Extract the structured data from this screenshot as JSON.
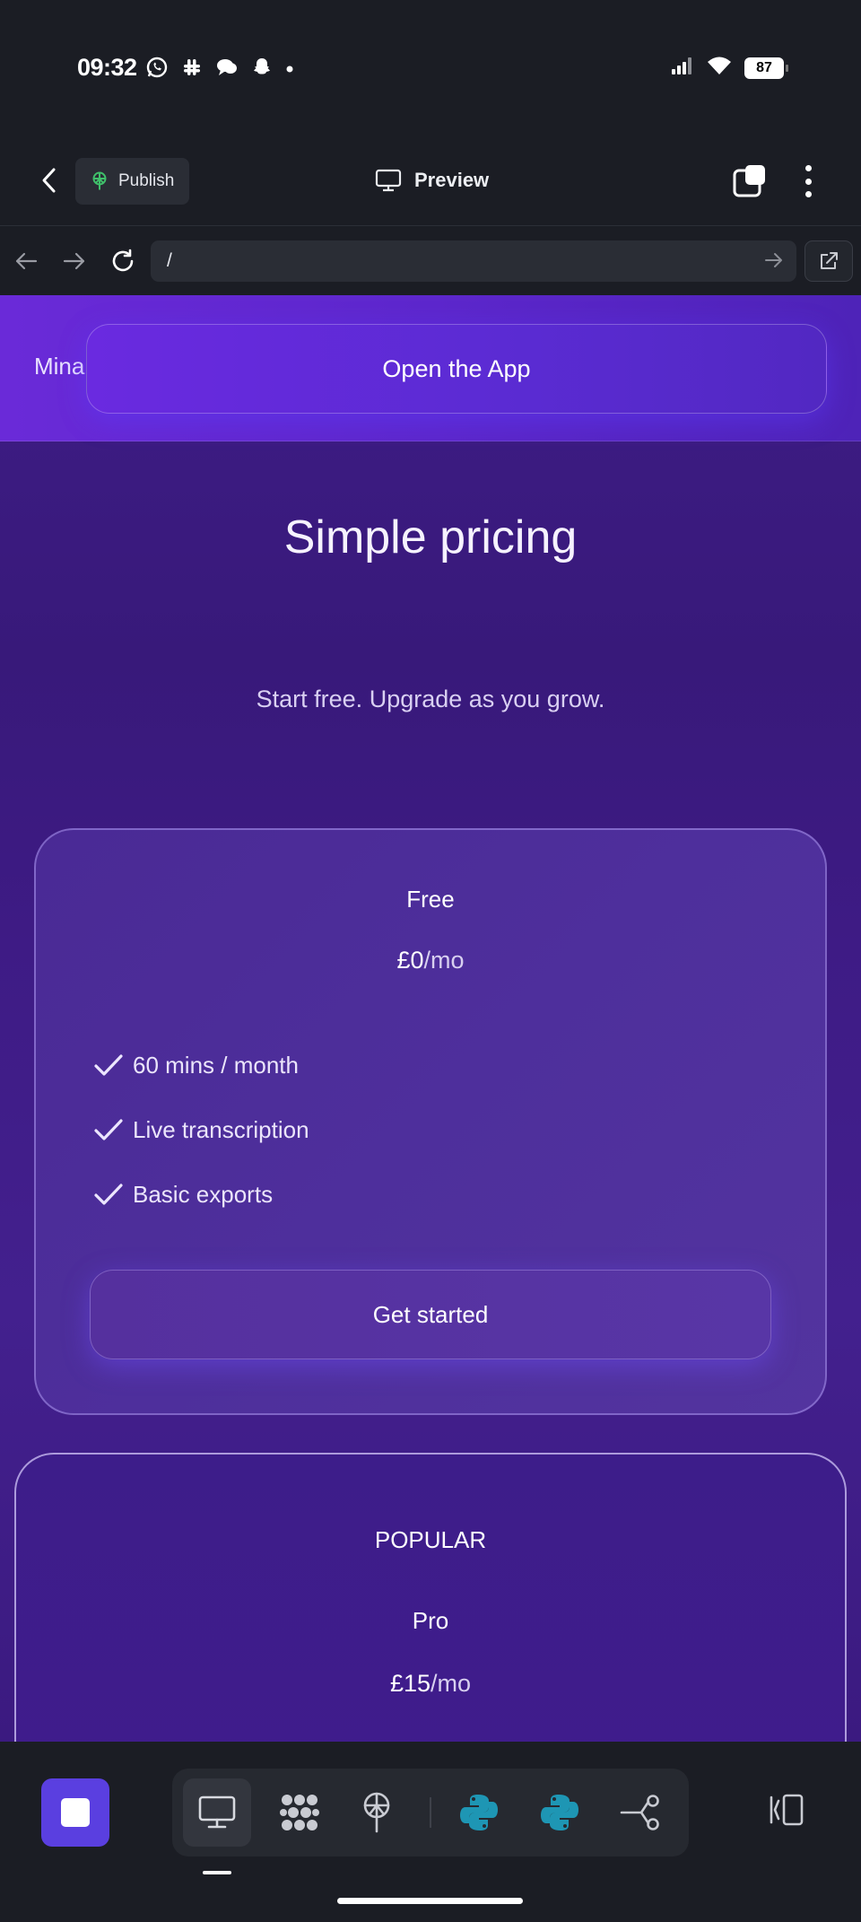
{
  "status_bar": {
    "time": "09:32",
    "notification_icons": [
      "whatsapp-icon",
      "slack-icon",
      "chat-bubbles-icon",
      "snapchat-icon",
      "dot-icon"
    ],
    "battery": "87"
  },
  "app_header": {
    "publish_label": "Publish",
    "preview_label": "Preview"
  },
  "browser": {
    "url": "/"
  },
  "site": {
    "brand": "Mina",
    "open_app_label": "Open the App",
    "title": "Simple pricing",
    "subtitle": "Start free. Upgrade as you grow.",
    "plans": [
      {
        "name": "Free",
        "price": "£0",
        "period": "/mo",
        "features": [
          "60 mins / month",
          "Live transcription",
          "Basic exports"
        ],
        "cta": "Get started"
      },
      {
        "badge": "POPULAR",
        "name": "Pro",
        "price": "£15",
        "period": "/mo"
      }
    ]
  },
  "colors": {
    "accent": "#5a3fe0",
    "python_blue": "#1e96b4",
    "background": "#1b1d24"
  }
}
